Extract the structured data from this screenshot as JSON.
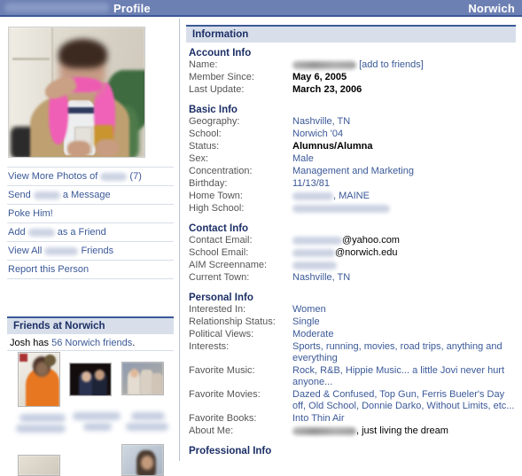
{
  "topbar": {
    "user_name_redacted": "",
    "page_title": "Profile",
    "network": "Norwich"
  },
  "sidebar": {
    "photo_alt": "profile-photo",
    "links": [
      {
        "name": "view-more-photos",
        "before": "View More Photos of",
        "redacted": true,
        "after": "(7)"
      },
      {
        "name": "send-message",
        "before": "Send",
        "redacted": true,
        "after": "a Message"
      },
      {
        "name": "poke-him",
        "before": "Poke Him!",
        "redacted": false,
        "after": ""
      },
      {
        "name": "add-as-friend",
        "before": "Add",
        "redacted": true,
        "after": "as a Friend"
      },
      {
        "name": "view-all-friends",
        "before": "View All",
        "redacted": true,
        "after": "Friends"
      },
      {
        "name": "report-this-person",
        "before": "Report this Person",
        "redacted": false,
        "after": ""
      }
    ],
    "friends_section": {
      "header": "Friends at Norwich",
      "count_prefix": "Josh has",
      "count_link": "56 Norwich friends",
      "count_suffix": "."
    }
  },
  "main": {
    "information_header": "Information",
    "groups": [
      {
        "title": "Account Info",
        "rows": [
          {
            "label": "Name:",
            "value": "",
            "redacted": true,
            "suffix": "[add to friends]",
            "style": "link"
          },
          {
            "label": "Member Since:",
            "value": "May 6, 2005",
            "redacted": false,
            "suffix": "",
            "style": "bold-black"
          },
          {
            "label": "Last Update:",
            "value": "March 23, 2006",
            "redacted": false,
            "suffix": "",
            "style": "bold-black"
          }
        ]
      },
      {
        "title": "Basic Info",
        "rows": [
          {
            "label": "Geography:",
            "value": "Nashville, TN",
            "redacted": false,
            "suffix": "",
            "style": "link"
          },
          {
            "label": "School:",
            "value": "Norwich '04",
            "redacted": false,
            "suffix": "",
            "style": "link"
          },
          {
            "label": "Status:",
            "value": "Alumnus/Alumna",
            "redacted": false,
            "suffix": "",
            "style": "bold-black"
          },
          {
            "label": "Sex:",
            "value": "Male",
            "redacted": false,
            "suffix": "",
            "style": "link"
          },
          {
            "label": "Concentration:",
            "value": "Management and Marketing",
            "redacted": false,
            "suffix": "",
            "style": "link"
          },
          {
            "label": "Birthday:",
            "value": "11/13/81",
            "redacted": false,
            "suffix": "",
            "style": "link"
          },
          {
            "label": "Home Town:",
            "value": "",
            "redacted": true,
            "suffix": ", MAINE",
            "style": "link"
          },
          {
            "label": "High School:",
            "value": "",
            "redacted": true,
            "suffix": "",
            "style": "link"
          }
        ]
      },
      {
        "title": "Contact Info",
        "rows": [
          {
            "label": "Contact Email:",
            "value": "",
            "redacted": true,
            "suffix": "@yahoo.com",
            "style": "plain-black"
          },
          {
            "label": "School Email:",
            "value": "",
            "redacted": true,
            "suffix": "@norwich.edu",
            "style": "plain-black"
          },
          {
            "label": "AIM Screenname:",
            "value": "",
            "redacted": true,
            "suffix": "",
            "style": "plain-black"
          },
          {
            "label": "Current Town:",
            "value": "Nashville, TN",
            "redacted": false,
            "suffix": "",
            "style": "link"
          }
        ]
      },
      {
        "title": "Personal Info",
        "rows": [
          {
            "label": "Interested In:",
            "value": "Women",
            "redacted": false,
            "suffix": "",
            "style": "link"
          },
          {
            "label": "Relationship Status:",
            "value": "Single",
            "redacted": false,
            "suffix": "",
            "style": "link"
          },
          {
            "label": "Political Views:",
            "value": "Moderate",
            "redacted": false,
            "suffix": "",
            "style": "link"
          },
          {
            "label": "Interests:",
            "value": "Sports, running, movies, road trips, anything and everything",
            "redacted": false,
            "suffix": "",
            "style": "link"
          },
          {
            "label": "Favorite Music:",
            "value": "Rock, R&B, Hippie Music... a little Jovi never hurt anyone...",
            "redacted": false,
            "suffix": "",
            "style": "link"
          },
          {
            "label": "Favorite Movies:",
            "value": "Dazed & Confused, Top Gun, Ferris Bueler's Day off, Old School, Donnie Darko, Without Limits, etc...",
            "redacted": false,
            "suffix": "",
            "style": "link"
          },
          {
            "label": "Favorite Books:",
            "value": "Into Thin Air",
            "redacted": false,
            "suffix": "",
            "style": "link"
          },
          {
            "label": "About Me:",
            "value": "",
            "redacted": true,
            "suffix": ", just living the dream",
            "style": "plain-black"
          }
        ]
      },
      {
        "title": "Professional Info",
        "rows": []
      }
    ]
  },
  "colors": {
    "topbar_bg": "#6d80b3",
    "topbar_border": "#3b5998",
    "section_bar_bg": "#d8dfea",
    "link_blue": "#3b5998",
    "heading_blue": "#1c2f66",
    "label_grey": "#555555"
  }
}
